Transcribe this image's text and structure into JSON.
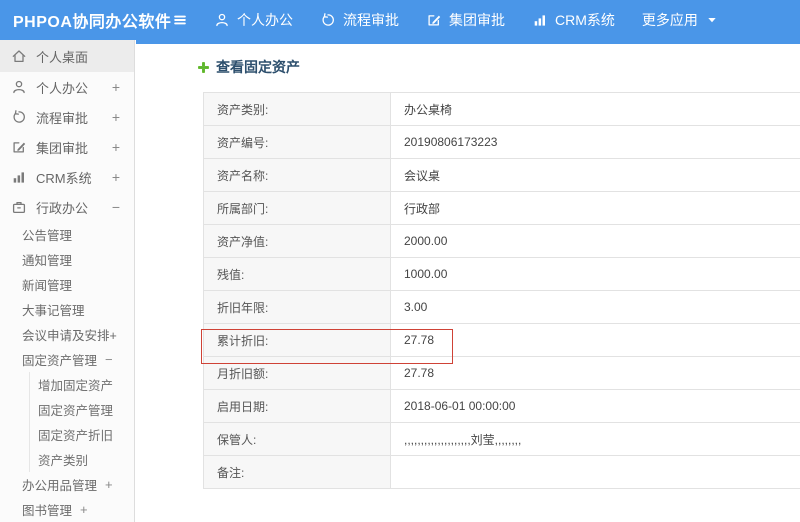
{
  "colors": {
    "topbar_blue": "#4a96e8",
    "title_navy": "#2d4f6d",
    "highlight_red": "#cf4236"
  },
  "header": {
    "logo": "PHPOA协同办公软件",
    "nav": [
      {
        "icon": "person-icon",
        "label": "个人办公"
      },
      {
        "icon": "history-icon",
        "label": "流程审批"
      },
      {
        "icon": "edit-icon",
        "label": "集团审批"
      },
      {
        "icon": "chart-icon",
        "label": "CRM系统"
      },
      {
        "icon": "apps-icon",
        "label": "更多应用",
        "caret": true
      }
    ]
  },
  "sidebar": {
    "items": [
      {
        "icon": "home-icon",
        "label": "个人桌面",
        "level": 0,
        "expand": "",
        "selected": true
      },
      {
        "icon": "person-icon",
        "label": "个人办公",
        "level": 0,
        "expand": "+"
      },
      {
        "icon": "history-icon",
        "label": "流程审批",
        "level": 0,
        "expand": "+"
      },
      {
        "icon": "edit-icon",
        "label": "集团审批",
        "level": 0,
        "expand": "+"
      },
      {
        "icon": "chart-icon",
        "label": "CRM系统",
        "level": 0,
        "expand": "+"
      },
      {
        "icon": "briefcase-icon",
        "label": "行政办公",
        "level": 0,
        "expand": "−"
      },
      {
        "label": "公告管理",
        "level": 1,
        "expand": ""
      },
      {
        "label": "通知管理",
        "level": 1,
        "expand": ""
      },
      {
        "label": "新闻管理",
        "level": 1,
        "expand": ""
      },
      {
        "label": "大事记管理",
        "level": 1,
        "expand": ""
      },
      {
        "label": "会议申请及安排+",
        "level": 1,
        "expand": ""
      },
      {
        "label": "固定资产管理",
        "level": 1,
        "expand": "−"
      },
      {
        "label": "增加固定资产",
        "level": 2,
        "expand": ""
      },
      {
        "label": "固定资产管理",
        "level": 2,
        "expand": ""
      },
      {
        "label": "固定资产折旧",
        "level": 2,
        "expand": ""
      },
      {
        "label": "资产类别",
        "level": 2,
        "expand": ""
      },
      {
        "label": "办公用品管理",
        "level": 1,
        "expand": "+"
      },
      {
        "label": "图书管理",
        "level": 1,
        "expand": "+"
      }
    ]
  },
  "main": {
    "title": "查看固定资产",
    "title_icon": "add-icon",
    "fields": [
      {
        "label": "资产类别:",
        "value": "办公桌椅"
      },
      {
        "label": "资产编号:",
        "value": "20190806173223"
      },
      {
        "label": "资产名称:",
        "value": "会议桌"
      },
      {
        "label": "所属部门:",
        "value": "行政部"
      },
      {
        "label": "资产净值:",
        "value": "2000.00"
      },
      {
        "label": "残值:",
        "value": "1000.00"
      },
      {
        "label": "折旧年限:",
        "value": "3.00"
      },
      {
        "label": "累计折旧:",
        "value": "27.78",
        "highlighted": true
      },
      {
        "label": "月折旧额:",
        "value": "27.78"
      },
      {
        "label": "启用日期:",
        "value": "2018-06-01 00:00:00"
      },
      {
        "label": "保管人:",
        "value": ",,,,,,,,,,,,,,,,,,,,刘莹,,,,,,,,"
      },
      {
        "label": "备注:",
        "value": ""
      }
    ]
  }
}
